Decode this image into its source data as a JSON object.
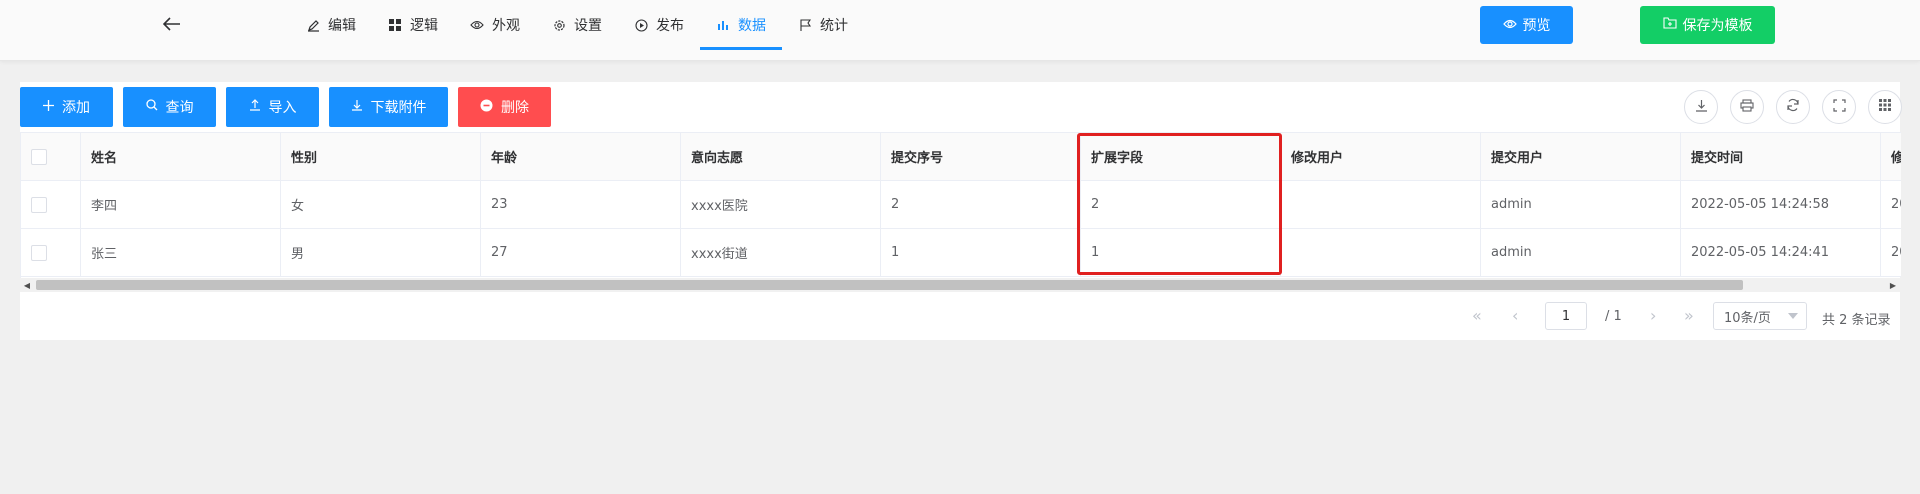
{
  "nav": {
    "tabs": [
      {
        "label": "编辑",
        "icon": "edit-icon"
      },
      {
        "label": "逻辑",
        "icon": "grid-icon"
      },
      {
        "label": "外观",
        "icon": "eye-icon"
      },
      {
        "label": "设置",
        "icon": "gear-icon"
      },
      {
        "label": "发布",
        "icon": "play-icon"
      },
      {
        "label": "数据",
        "icon": "bar-chart-icon",
        "active": true
      },
      {
        "label": "统计",
        "icon": "flag-icon"
      }
    ],
    "preview_label": "预览",
    "save_template_label": "保存为模板"
  },
  "toolbar": {
    "add": "添加",
    "query": "查询",
    "import": "导入",
    "download": "下载附件",
    "delete": "删除"
  },
  "table": {
    "headers": [
      "姓名",
      "性别",
      "年龄",
      "意向志愿",
      "提交序号",
      "扩展字段",
      "修改用户",
      "提交用户",
      "提交时间",
      "修"
    ],
    "rows": [
      [
        "李四",
        "女",
        "23",
        "xxxx医院",
        "2",
        "2",
        "",
        "admin",
        "2022-05-05 14:24:58",
        "20"
      ],
      [
        "张三",
        "男",
        "27",
        "xxxx街道",
        "1",
        "1",
        "",
        "admin",
        "2022-05-05 14:24:41",
        "20"
      ]
    ]
  },
  "pagination": {
    "current_page": "1",
    "total_pages": "/ 1",
    "page_size": "10条/页",
    "records": "共 2 条记录"
  },
  "colors": {
    "primary": "#1890ff",
    "success": "#13ce66",
    "danger": "#ff4d4f",
    "highlight": "#e02020"
  }
}
